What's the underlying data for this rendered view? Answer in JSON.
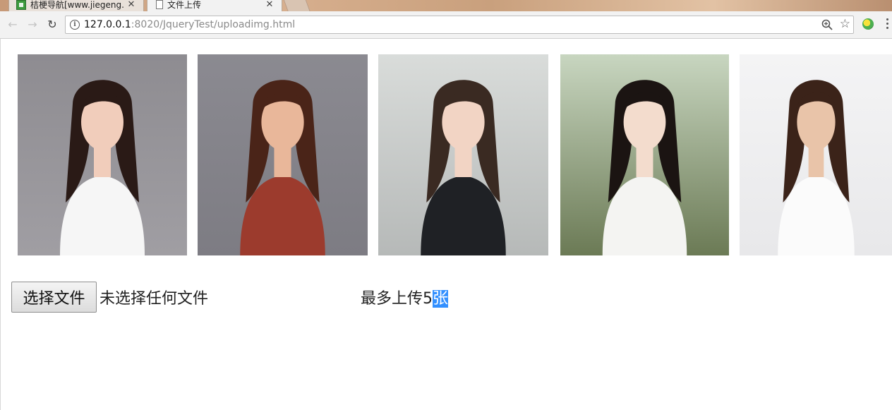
{
  "browser": {
    "tabs": [
      {
        "title": "桔梗导航[www.jiegeng.",
        "active": false
      },
      {
        "title": "文件上传",
        "active": true
      }
    ],
    "url_host": "127.0.0.1",
    "url_rest": ":8020/JqueryTest/uploadimg.html"
  },
  "gallery": {
    "photos": [
      {
        "name": "photo-1",
        "bg": "#a09ea3",
        "top": "#8e8c91",
        "hair": "#2a1a16",
        "skin": "#f1cdbb",
        "cloth": "#f6f6f6"
      },
      {
        "name": "photo-2",
        "bg": "#7d7c83",
        "top": "#8b8a91",
        "hair": "#4a2418",
        "skin": "#e9b79a",
        "cloth": "#9c3b2d"
      },
      {
        "name": "photo-3",
        "bg": "#b6b9b8",
        "top": "#d9dcda",
        "hair": "#3a2a22",
        "skin": "#f2d4c4",
        "cloth": "#1f2125"
      },
      {
        "name": "photo-4",
        "bg": "#6b7a55",
        "top": "#c8d6c0",
        "hair": "#1b1412",
        "skin": "#f3dccd",
        "cloth": "#f4f4f2"
      },
      {
        "name": "photo-5",
        "bg": "#e8e8ea",
        "top": "#f4f4f5",
        "hair": "#3b2319",
        "skin": "#e9c4a9",
        "cloth": "#fbfbfb"
      }
    ]
  },
  "upload": {
    "button_label": "选择文件",
    "status": "未选择任何文件",
    "limit_prefix": "最多上传5",
    "limit_selected": "张"
  }
}
